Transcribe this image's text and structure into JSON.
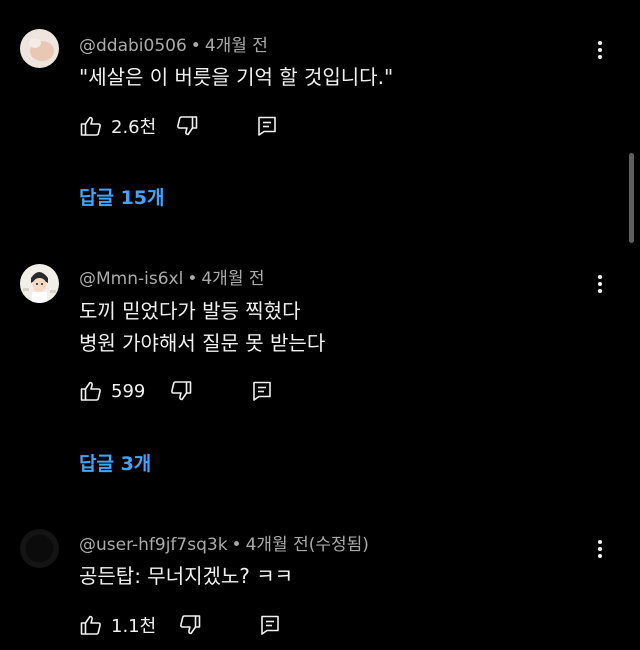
{
  "comments": [
    {
      "handle": "@ddabi0506",
      "time": "4개월 전",
      "lines": [
        "\"세살은 이 버릇을 기억 할 것입니다.\""
      ],
      "likes": "2.6천",
      "replies": "답글 15개",
      "avatar_icon": "peach-blob-avatar"
    },
    {
      "handle": "@Mmn-is6xl",
      "time": "4개월 전",
      "lines": [
        "도끼 믿었다가 발등 찍혔다",
        "병원 가야해서 질문 못 받는다"
      ],
      "likes": "599",
      "replies": "답글 3개",
      "avatar_icon": "cartoon-character-avatar"
    },
    {
      "handle": "@user-hf9jf7sq3k",
      "time": "4개월 전(수정됨)",
      "lines": [
        "공든탑: 무너지겠노? ㅋㅋ"
      ],
      "likes": "1.1천",
      "avatar_icon": "dark-avatar"
    }
  ],
  "icons": {
    "like": "thumb-up-icon",
    "dislike": "thumb-down-icon",
    "reply": "reply-comment-icon",
    "more": "more-vertical-icon"
  },
  "colors": {
    "background": "#000000",
    "text": "#f1f1f1",
    "secondary_text": "#aaaaaa",
    "link": "#3ea6ff"
  }
}
